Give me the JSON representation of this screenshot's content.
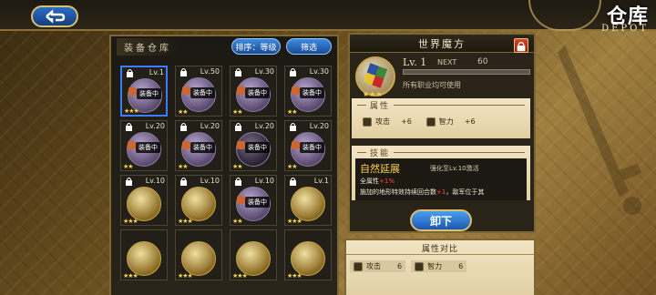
{
  "header": {
    "back_icon": "back-arrow-icon",
    "title_cn": "仓库",
    "title_en": "DEPOT"
  },
  "inventory": {
    "title": "装备仓库",
    "sort_label": "排序：等级",
    "filter_label": "筛选",
    "equipped_tag": "装备中",
    "items": [
      {
        "level": "Lv.1",
        "locked": true,
        "equipped": true,
        "selected": true,
        "style": "purple",
        "stars": "★★★"
      },
      {
        "level": "Lv.50",
        "locked": true,
        "equipped": true,
        "selected": false,
        "style": "purple",
        "stars": "★★"
      },
      {
        "level": "Lv.30",
        "locked": true,
        "equipped": true,
        "selected": false,
        "style": "purple",
        "stars": "★★"
      },
      {
        "level": "Lv.30",
        "locked": true,
        "equipped": true,
        "selected": false,
        "style": "purple",
        "stars": "★★"
      },
      {
        "level": "Lv.20",
        "locked": true,
        "equipped": true,
        "selected": false,
        "style": "purple",
        "stars": "★★"
      },
      {
        "level": "Lv.20",
        "locked": true,
        "equipped": true,
        "selected": false,
        "style": "purple",
        "stars": "★★"
      },
      {
        "level": "Lv.20",
        "locked": true,
        "equipped": true,
        "selected": false,
        "style": "dark",
        "stars": "★★"
      },
      {
        "level": "Lv.20",
        "locked": true,
        "equipped": true,
        "selected": false,
        "style": "purple",
        "stars": "★★"
      },
      {
        "level": "Lv.10",
        "locked": true,
        "equipped": false,
        "selected": false,
        "style": "gold",
        "stars": "★★★"
      },
      {
        "level": "Lv.10",
        "locked": true,
        "equipped": false,
        "selected": false,
        "style": "gold",
        "stars": "★★★"
      },
      {
        "level": "Lv.10",
        "locked": true,
        "equipped": true,
        "selected": false,
        "style": "purple",
        "stars": "★★"
      },
      {
        "level": "Lv.1",
        "locked": true,
        "equipped": false,
        "selected": false,
        "style": "gold",
        "stars": "★★★"
      },
      {
        "level": "",
        "locked": false,
        "equipped": false,
        "selected": false,
        "style": "gold",
        "stars": "★★★"
      },
      {
        "level": "",
        "locked": false,
        "equipped": false,
        "selected": false,
        "style": "gold",
        "stars": "★★★"
      },
      {
        "level": "",
        "locked": false,
        "equipped": false,
        "selected": false,
        "style": "gold",
        "stars": "★★★"
      },
      {
        "level": "",
        "locked": false,
        "equipped": false,
        "selected": false,
        "style": "gold",
        "stars": "★★★"
      }
    ]
  },
  "detail": {
    "name": "世界魔方",
    "level": "Lv. 1",
    "next_label": "NEXT",
    "next_value": "60",
    "stars": "★★★",
    "usable_text": "所有职业均可使用",
    "attributes_label": "属性",
    "attributes": [
      {
        "icon": "attack-icon",
        "name": "攻击",
        "value": "+6"
      },
      {
        "icon": "intelligence-icon",
        "name": "智力",
        "value": "+6"
      }
    ],
    "skill_label": "技能",
    "skill_name": "自然延展",
    "skill_unlock": "强化至Lv.10激活",
    "skill_line1_prefix": "全属性",
    "skill_line1_red": "+1%",
    "skill_line2_prefix": "施加的地形特效持续回合数",
    "skill_line2_red": "+1",
    "skill_line2_suffix": "，敌军位于其",
    "unequip_label": "卸下"
  },
  "compare": {
    "title": "属性对比",
    "items": [
      {
        "icon": "attack-icon",
        "name": "攻击",
        "value": "6"
      },
      {
        "icon": "intelligence-icon",
        "name": "智力",
        "value": "6"
      }
    ]
  },
  "colors": {
    "accent_blue": "#2a6cc8",
    "gold_border": "#d8c070",
    "skill_gold": "#ffd24a",
    "bonus_red": "#ff4444"
  }
}
